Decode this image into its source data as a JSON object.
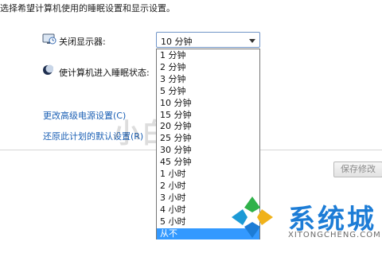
{
  "intro_text": "选择希望计算机使用的睡眠设置和显示设置。",
  "settings": {
    "turn_off_display_label": "关闭显示器:",
    "turn_off_display_value": "10 分钟",
    "sleep_label": "使计算机进入睡眠状态:"
  },
  "dropdown": {
    "options": [
      "1 分钟",
      "2 分钟",
      "3 分钟",
      "5 分钟",
      "10 分钟",
      "15 分钟",
      "20 分钟",
      "25 分钟",
      "30 分钟",
      "45 分钟",
      "1 小时",
      "2 小时",
      "3 小时",
      "4 小时",
      "5 小时",
      "从不"
    ],
    "highlighted": "从不"
  },
  "links": {
    "advanced": "更改高级电源设置(C)",
    "restore_defaults": "还原此计划的默认设置(R)"
  },
  "buttons": {
    "save": "保存修改"
  },
  "watermark_text": "小白教程网",
  "brand": {
    "name": "系统城",
    "site": "XITONGCHENG.COM"
  }
}
